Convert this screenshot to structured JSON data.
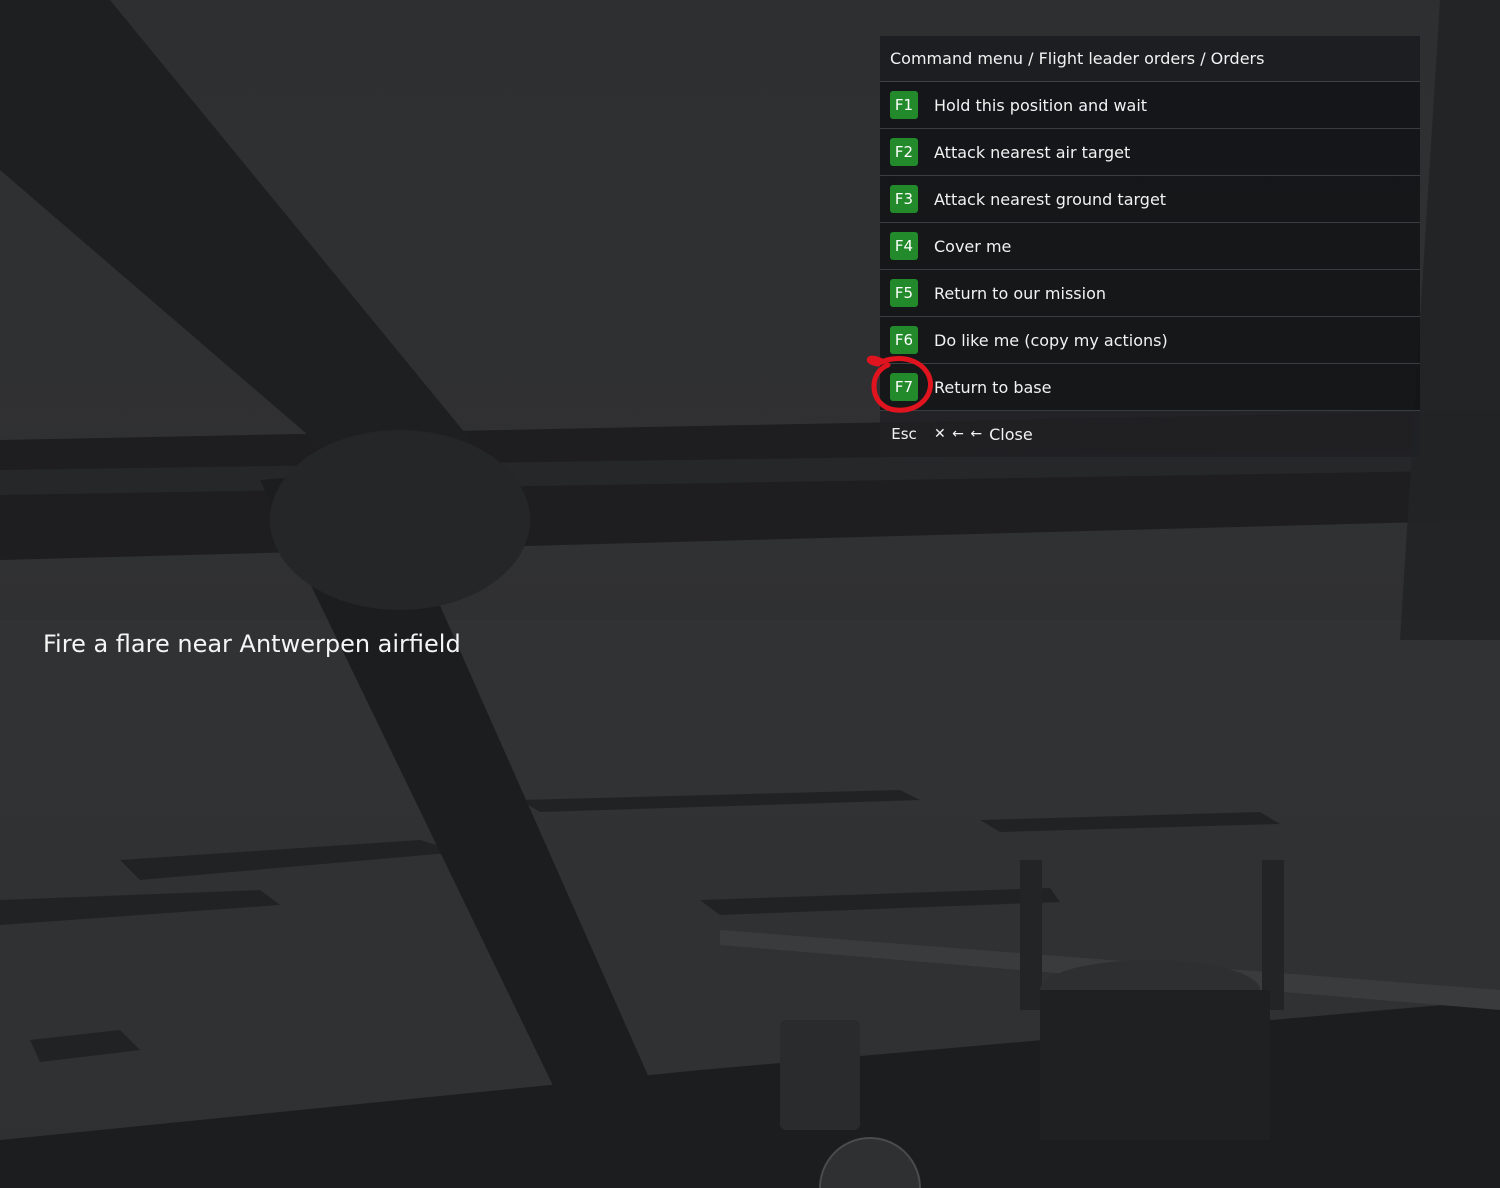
{
  "command_menu": {
    "breadcrumb": "Command menu / Flight leader orders / Orders",
    "items": [
      {
        "key": "F1",
        "label": "Hold this position and wait"
      },
      {
        "key": "F2",
        "label": "Attack nearest air target"
      },
      {
        "key": "F3",
        "label": "Attack nearest ground target"
      },
      {
        "key": "F4",
        "label": "Cover me"
      },
      {
        "key": "F5",
        "label": "Return to our mission"
      },
      {
        "key": "F6",
        "label": "Do like me (copy my actions)"
      },
      {
        "key": "F7",
        "label": "Return to base"
      }
    ],
    "close": {
      "key": "Esc",
      "icons": "✕ ← ←",
      "label": "Close"
    },
    "key_color": "#228a2a"
  },
  "mission_message": "Fire a flare near Antwerpen airfield",
  "annotation": {
    "circled_item": "F7",
    "color": "#e0141e"
  }
}
